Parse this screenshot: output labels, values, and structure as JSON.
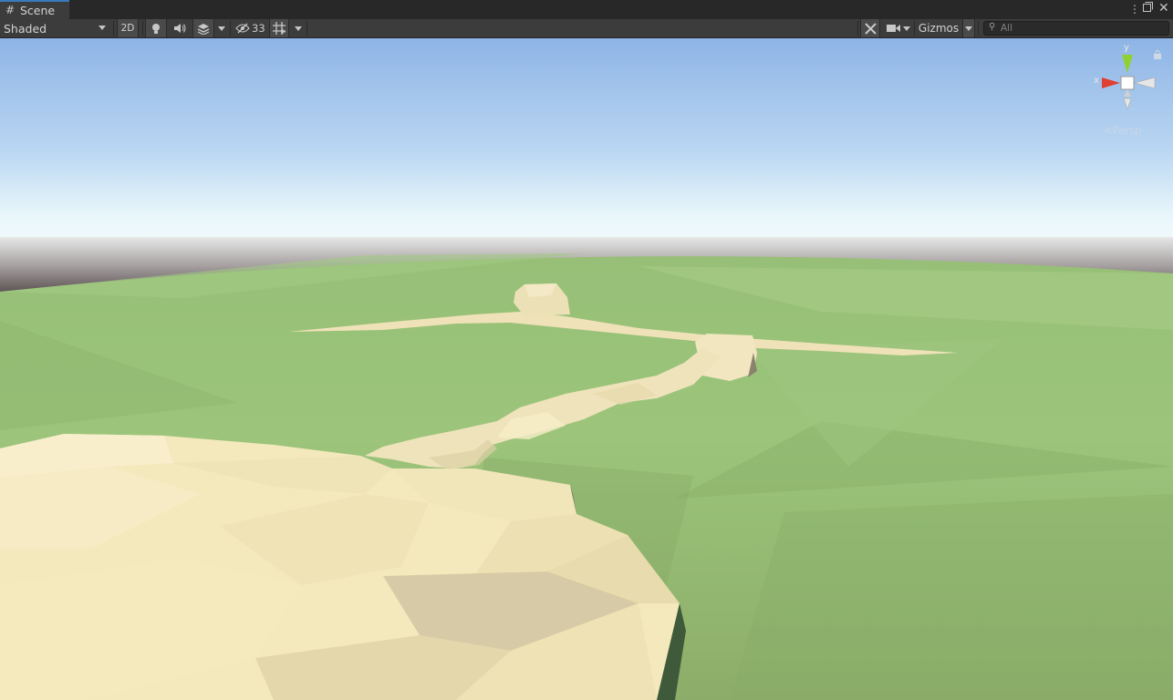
{
  "tab": {
    "icon": "grid-hash-icon",
    "label": "Scene"
  },
  "window_controls": {
    "menu_icon": "kebab-menu-icon",
    "maximize_icon": "maximize-icon",
    "close_icon": "close-icon"
  },
  "toolbar": {
    "draw_mode": "Shaded",
    "mode_2d": "2D",
    "lighting_icon": "lightbulb-icon",
    "audio_icon": "speaker-icon",
    "effects_icon": "layers-icon",
    "hidden_icon": "eye-hidden-icon",
    "hidden_count": "33",
    "grid_icon": "grid-icon",
    "tools_icon": "tools-icon",
    "camera_icon": "camera-icon",
    "gizmos_label": "Gizmos",
    "search_placeholder": "All"
  },
  "orientation_gizmo": {
    "y_label": "y",
    "x_label": "x",
    "projection": "Persp"
  },
  "colors": {
    "accent": "#3a79bb",
    "sky_top": "#8eb4e6",
    "ground": "#93b671",
    "terrain": "#f3e7b9",
    "axis_x": "#e0402f",
    "axis_y": "#8fd12f"
  }
}
